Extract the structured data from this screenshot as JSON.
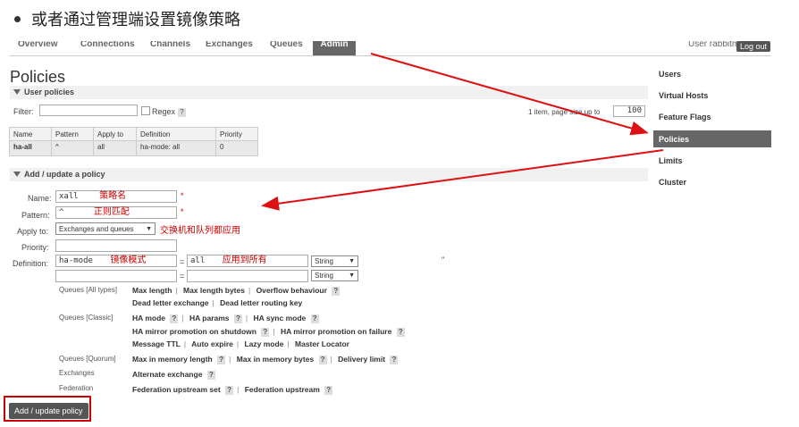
{
  "caption": "或者通过管理端设置镜像策略",
  "topnav": {
    "tabs": [
      "Overview",
      "Connections",
      "Channels",
      "Exchanges",
      "Queues",
      "Admin"
    ],
    "active_tab": "Admin",
    "user_text": "User rabbitmq",
    "logout_label": "Log out"
  },
  "page_title": "Policies",
  "user_policies": {
    "header": "User policies",
    "filter_label": "Filter:",
    "regex_label": "Regex",
    "qmark": "?",
    "page_info": "1 item, page size up to",
    "page_size": "100",
    "columns": [
      "Name",
      "Pattern",
      "Apply to",
      "Definition",
      "Priority"
    ],
    "rows": [
      {
        "name": "ha-all",
        "pattern": "^",
        "apply_to": "all",
        "definition_key": "ha-mode:",
        "definition_val": "all",
        "priority": "0"
      }
    ]
  },
  "add_policy": {
    "header": "Add / update a policy",
    "name_label": "Name:",
    "name_value": "xall",
    "name_note": "策略名",
    "pattern_label": "Pattern:",
    "pattern_value": "^",
    "pattern_note": "正则匹配",
    "apply_label": "Apply to:",
    "apply_value": "Exchanges and queues",
    "apply_note": "交换机和队列都应用",
    "priority_label": "Priority:",
    "definition_label": "Definition:",
    "def_key": "ha-mode",
    "def_key_note": "镜像模式",
    "def_eq": "=",
    "def_val": "all",
    "def_val_note": "应用到所有",
    "type_value": "String",
    "required_mark": "*",
    "quote_mark": "\"",
    "button_label": "Add / update policy"
  },
  "keywords": [
    {
      "group": "Queues [All types]",
      "lines": [
        [
          "Max length",
          "Max length bytes",
          "Overflow behaviour"
        ],
        [
          "Dead letter exchange",
          "Dead letter routing key"
        ]
      ]
    },
    {
      "group": "Queues [Classic]",
      "lines": [
        [
          "HA mode",
          "HA params",
          "HA sync mode"
        ],
        [
          "HA mirror promotion on shutdown",
          "HA mirror promotion on failure"
        ],
        [
          "Message TTL",
          "Auto expire",
          "Lazy mode",
          "Master Locator"
        ]
      ]
    },
    {
      "group": "Queues [Quorum]",
      "lines": [
        [
          "Max in memory length",
          "Max in memory bytes",
          "Delivery limit"
        ]
      ]
    },
    {
      "group": "Exchanges",
      "lines": [
        [
          "Alternate exchange"
        ]
      ]
    },
    {
      "group": "Federation",
      "lines": [
        [
          "Federation upstream set",
          "Federation upstream"
        ]
      ]
    }
  ],
  "sidebar": {
    "items": [
      "Users",
      "Virtual Hosts",
      "Feature Flags",
      "Policies",
      "Limits",
      "Cluster"
    ],
    "active": "Policies"
  },
  "colors": {
    "annotation": "#cc0000",
    "arrow": "#d11",
    "active_bg": "#666666"
  }
}
